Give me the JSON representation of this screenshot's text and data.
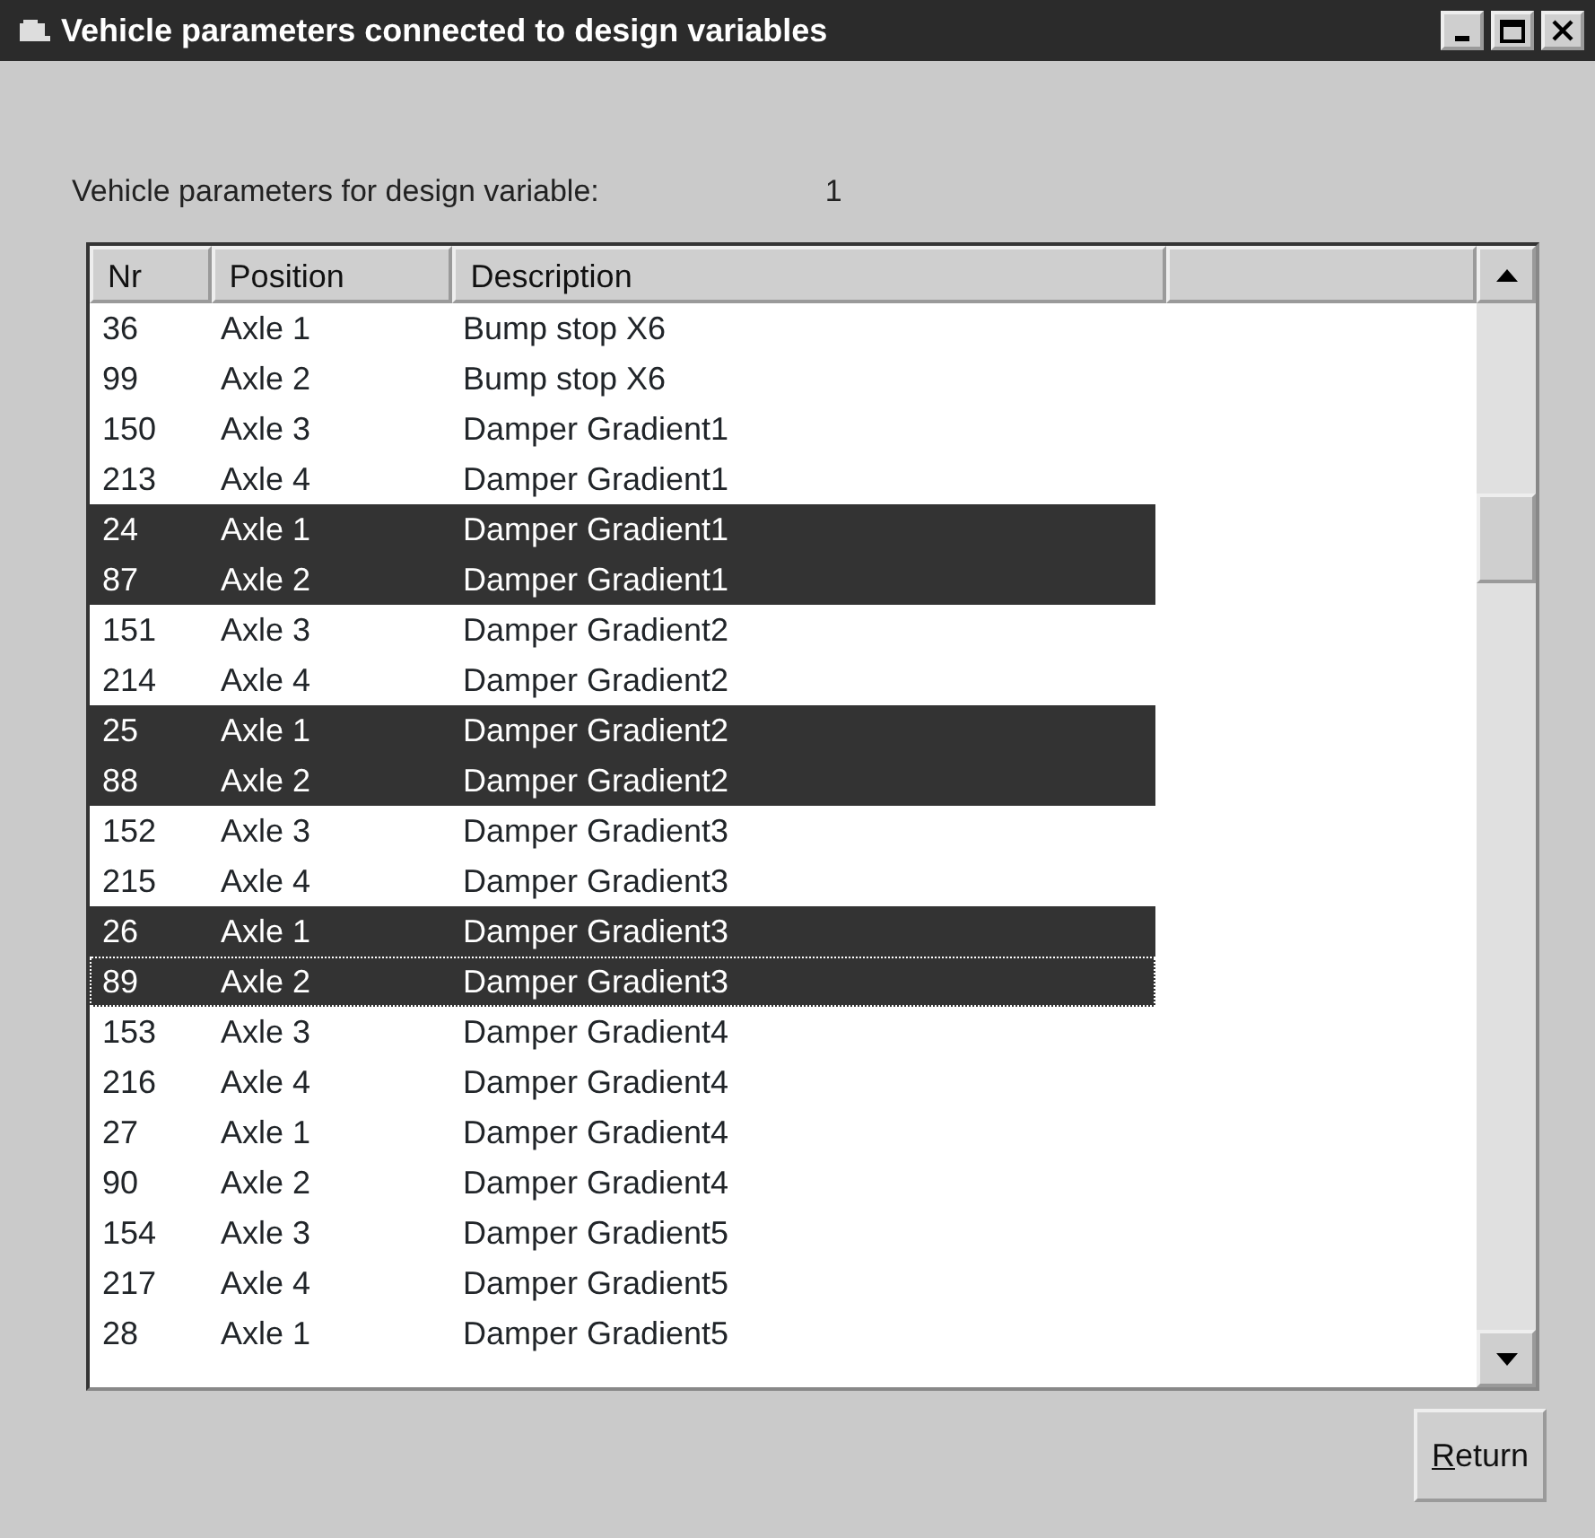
{
  "window": {
    "title": "Vehicle parameters connected to design variables"
  },
  "design_variable": {
    "label": "Vehicle parameters for design variable:",
    "value": "1"
  },
  "table": {
    "columns": [
      "Nr",
      "Position",
      "Description"
    ],
    "rows": [
      {
        "nr": "36",
        "position": "Axle 1",
        "description": "Bump stop X6",
        "selected": false,
        "focused": false
      },
      {
        "nr": "99",
        "position": "Axle 2",
        "description": "Bump stop X6",
        "selected": false,
        "focused": false
      },
      {
        "nr": "150",
        "position": "Axle 3",
        "description": "Damper Gradient1",
        "selected": false,
        "focused": false
      },
      {
        "nr": "213",
        "position": "Axle 4",
        "description": "Damper Gradient1",
        "selected": false,
        "focused": false
      },
      {
        "nr": "24",
        "position": "Axle 1",
        "description": "Damper Gradient1",
        "selected": true,
        "focused": false
      },
      {
        "nr": "87",
        "position": "Axle 2",
        "description": "Damper Gradient1",
        "selected": true,
        "focused": false
      },
      {
        "nr": "151",
        "position": "Axle 3",
        "description": "Damper Gradient2",
        "selected": false,
        "focused": false
      },
      {
        "nr": "214",
        "position": "Axle 4",
        "description": "Damper Gradient2",
        "selected": false,
        "focused": false
      },
      {
        "nr": "25",
        "position": "Axle 1",
        "description": "Damper Gradient2",
        "selected": true,
        "focused": false
      },
      {
        "nr": "88",
        "position": "Axle 2",
        "description": "Damper Gradient2",
        "selected": true,
        "focused": false
      },
      {
        "nr": "152",
        "position": "Axle 3",
        "description": "Damper Gradient3",
        "selected": false,
        "focused": false
      },
      {
        "nr": "215",
        "position": "Axle 4",
        "description": "Damper Gradient3",
        "selected": false,
        "focused": false
      },
      {
        "nr": "26",
        "position": "Axle 1",
        "description": "Damper Gradient3",
        "selected": true,
        "focused": false
      },
      {
        "nr": "89",
        "position": "Axle 2",
        "description": "Damper Gradient3",
        "selected": true,
        "focused": true
      },
      {
        "nr": "153",
        "position": "Axle 3",
        "description": "Damper Gradient4",
        "selected": false,
        "focused": false
      },
      {
        "nr": "216",
        "position": "Axle 4",
        "description": "Damper Gradient4",
        "selected": false,
        "focused": false
      },
      {
        "nr": "27",
        "position": "Axle 1",
        "description": "Damper Gradient4",
        "selected": false,
        "focused": false
      },
      {
        "nr": "90",
        "position": "Axle 2",
        "description": "Damper Gradient4",
        "selected": false,
        "focused": false
      },
      {
        "nr": "154",
        "position": "Axle 3",
        "description": "Damper Gradient5",
        "selected": false,
        "focused": false
      },
      {
        "nr": "217",
        "position": "Axle 4",
        "description": "Damper Gradient5",
        "selected": false,
        "focused": false
      },
      {
        "nr": "28",
        "position": "Axle 1",
        "description": "Damper Gradient5",
        "selected": false,
        "focused": false
      }
    ]
  },
  "buttons": [
    {
      "label": "Return",
      "mnemonic_underline": true
    }
  ]
}
